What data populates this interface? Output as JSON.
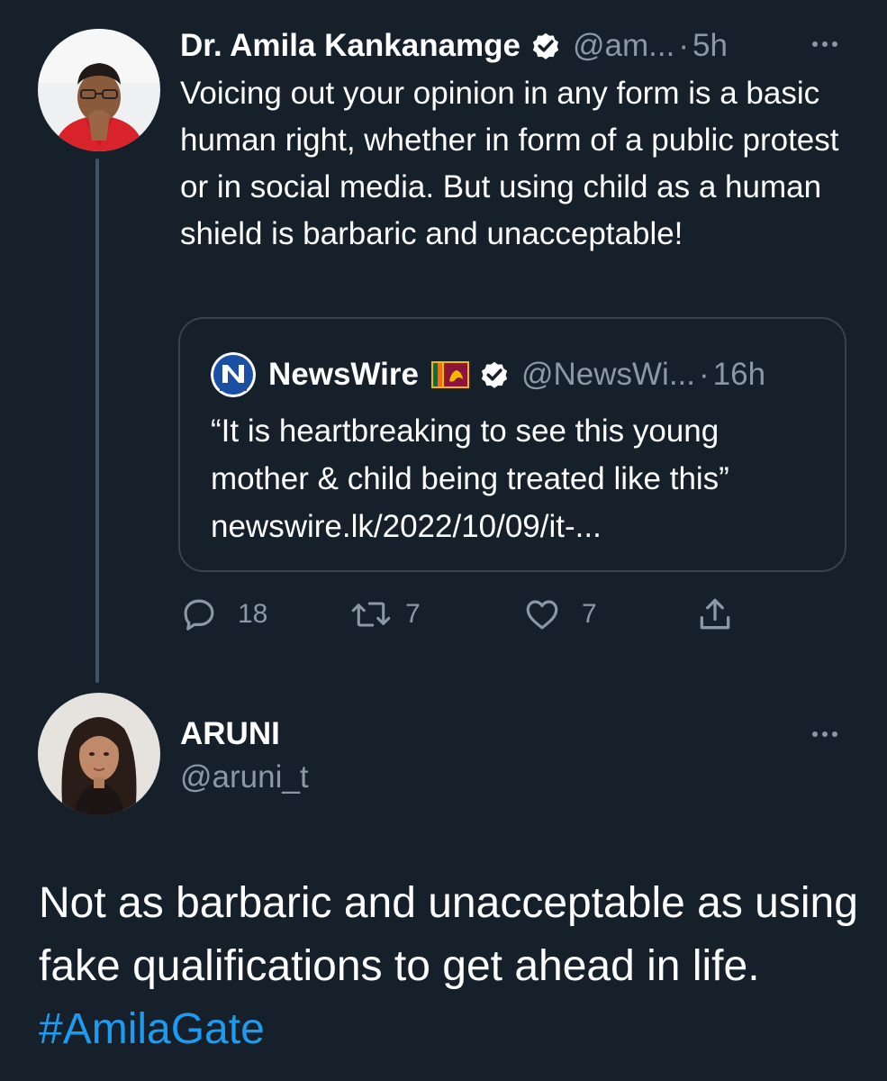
{
  "tweet1": {
    "author": {
      "display_name": "Dr. Amila Kankanamge",
      "handle": "@am...",
      "verified": true,
      "avatar_icon": "person-avatar"
    },
    "separator": "·",
    "time": "5h",
    "text": "Voicing out your opinion in any form is a basic human right, whether in form of a public protest or in social media. But using child as a human shield is barbaric and unacceptable!",
    "more_icon": "more-horizontal-icon",
    "quote": {
      "logo_icon": "newswire-logo",
      "logo_text": "N",
      "logo_subtext": "NEWSWIRE",
      "display_name": "NewsWire",
      "flag_icon": "sri-lanka-flag",
      "verified": true,
      "handle": "@NewsWi...",
      "separator": "·",
      "time": "16h",
      "text": "“It is heartbreaking to see this young mother & child being treated like this”",
      "link": "newswire.lk/2022/10/09/it-..."
    },
    "actions": {
      "reply": {
        "icon": "reply-icon",
        "count": "18"
      },
      "retweet": {
        "icon": "retweet-icon",
        "count": "7"
      },
      "like": {
        "icon": "heart-icon",
        "count": "7"
      },
      "share": {
        "icon": "share-icon"
      }
    }
  },
  "tweet2": {
    "author": {
      "display_name": "ARUNI",
      "handle": "@aruni_t",
      "avatar_icon": "person-avatar"
    },
    "more_icon": "more-horizontal-icon",
    "text": "Not as barbaric and unacceptable as using fake qualifications to get ahead in life.",
    "hashtag": "#AmilaGate"
  },
  "colors": {
    "background": "#15202b",
    "text": "#ffffff",
    "muted": "#8b98a5",
    "link": "#1d9bf0",
    "border": "#38444d",
    "thread_line": "#3d5466"
  }
}
